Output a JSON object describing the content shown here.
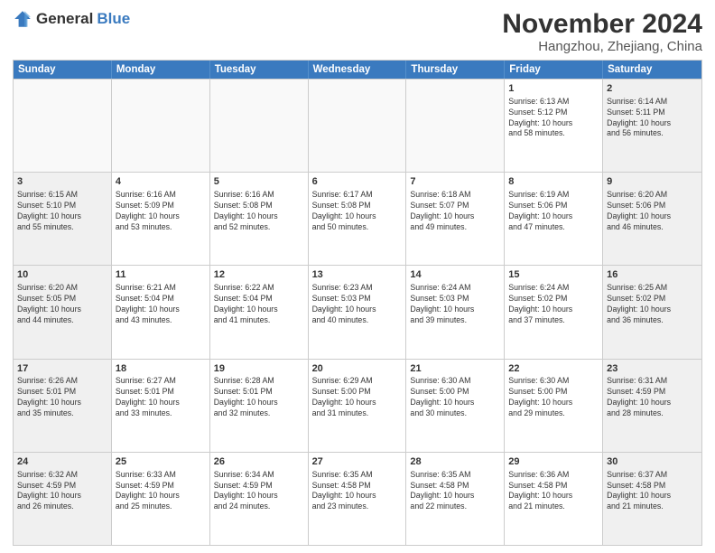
{
  "logo": {
    "general": "General",
    "blue": "Blue"
  },
  "title": "November 2024",
  "location": "Hangzhou, Zhejiang, China",
  "header_days": [
    "Sunday",
    "Monday",
    "Tuesday",
    "Wednesday",
    "Thursday",
    "Friday",
    "Saturday"
  ],
  "weeks": [
    [
      {
        "day": "",
        "text": "",
        "empty": true
      },
      {
        "day": "",
        "text": "",
        "empty": true
      },
      {
        "day": "",
        "text": "",
        "empty": true
      },
      {
        "day": "",
        "text": "",
        "empty": true
      },
      {
        "day": "",
        "text": "",
        "empty": true
      },
      {
        "day": "1",
        "text": "Sunrise: 6:13 AM\nSunset: 5:12 PM\nDaylight: 10 hours\nand 58 minutes.",
        "empty": false
      },
      {
        "day": "2",
        "text": "Sunrise: 6:14 AM\nSunset: 5:11 PM\nDaylight: 10 hours\nand 56 minutes.",
        "empty": false
      }
    ],
    [
      {
        "day": "3",
        "text": "Sunrise: 6:15 AM\nSunset: 5:10 PM\nDaylight: 10 hours\nand 55 minutes.",
        "empty": false
      },
      {
        "day": "4",
        "text": "Sunrise: 6:16 AM\nSunset: 5:09 PM\nDaylight: 10 hours\nand 53 minutes.",
        "empty": false
      },
      {
        "day": "5",
        "text": "Sunrise: 6:16 AM\nSunset: 5:08 PM\nDaylight: 10 hours\nand 52 minutes.",
        "empty": false
      },
      {
        "day": "6",
        "text": "Sunrise: 6:17 AM\nSunset: 5:08 PM\nDaylight: 10 hours\nand 50 minutes.",
        "empty": false
      },
      {
        "day": "7",
        "text": "Sunrise: 6:18 AM\nSunset: 5:07 PM\nDaylight: 10 hours\nand 49 minutes.",
        "empty": false
      },
      {
        "day": "8",
        "text": "Sunrise: 6:19 AM\nSunset: 5:06 PM\nDaylight: 10 hours\nand 47 minutes.",
        "empty": false
      },
      {
        "day": "9",
        "text": "Sunrise: 6:20 AM\nSunset: 5:06 PM\nDaylight: 10 hours\nand 46 minutes.",
        "empty": false
      }
    ],
    [
      {
        "day": "10",
        "text": "Sunrise: 6:20 AM\nSunset: 5:05 PM\nDaylight: 10 hours\nand 44 minutes.",
        "empty": false
      },
      {
        "day": "11",
        "text": "Sunrise: 6:21 AM\nSunset: 5:04 PM\nDaylight: 10 hours\nand 43 minutes.",
        "empty": false
      },
      {
        "day": "12",
        "text": "Sunrise: 6:22 AM\nSunset: 5:04 PM\nDaylight: 10 hours\nand 41 minutes.",
        "empty": false
      },
      {
        "day": "13",
        "text": "Sunrise: 6:23 AM\nSunset: 5:03 PM\nDaylight: 10 hours\nand 40 minutes.",
        "empty": false
      },
      {
        "day": "14",
        "text": "Sunrise: 6:24 AM\nSunset: 5:03 PM\nDaylight: 10 hours\nand 39 minutes.",
        "empty": false
      },
      {
        "day": "15",
        "text": "Sunrise: 6:24 AM\nSunset: 5:02 PM\nDaylight: 10 hours\nand 37 minutes.",
        "empty": false
      },
      {
        "day": "16",
        "text": "Sunrise: 6:25 AM\nSunset: 5:02 PM\nDaylight: 10 hours\nand 36 minutes.",
        "empty": false
      }
    ],
    [
      {
        "day": "17",
        "text": "Sunrise: 6:26 AM\nSunset: 5:01 PM\nDaylight: 10 hours\nand 35 minutes.",
        "empty": false
      },
      {
        "day": "18",
        "text": "Sunrise: 6:27 AM\nSunset: 5:01 PM\nDaylight: 10 hours\nand 33 minutes.",
        "empty": false
      },
      {
        "day": "19",
        "text": "Sunrise: 6:28 AM\nSunset: 5:01 PM\nDaylight: 10 hours\nand 32 minutes.",
        "empty": false
      },
      {
        "day": "20",
        "text": "Sunrise: 6:29 AM\nSunset: 5:00 PM\nDaylight: 10 hours\nand 31 minutes.",
        "empty": false
      },
      {
        "day": "21",
        "text": "Sunrise: 6:30 AM\nSunset: 5:00 PM\nDaylight: 10 hours\nand 30 minutes.",
        "empty": false
      },
      {
        "day": "22",
        "text": "Sunrise: 6:30 AM\nSunset: 5:00 PM\nDaylight: 10 hours\nand 29 minutes.",
        "empty": false
      },
      {
        "day": "23",
        "text": "Sunrise: 6:31 AM\nSunset: 4:59 PM\nDaylight: 10 hours\nand 28 minutes.",
        "empty": false
      }
    ],
    [
      {
        "day": "24",
        "text": "Sunrise: 6:32 AM\nSunset: 4:59 PM\nDaylight: 10 hours\nand 26 minutes.",
        "empty": false
      },
      {
        "day": "25",
        "text": "Sunrise: 6:33 AM\nSunset: 4:59 PM\nDaylight: 10 hours\nand 25 minutes.",
        "empty": false
      },
      {
        "day": "26",
        "text": "Sunrise: 6:34 AM\nSunset: 4:59 PM\nDaylight: 10 hours\nand 24 minutes.",
        "empty": false
      },
      {
        "day": "27",
        "text": "Sunrise: 6:35 AM\nSunset: 4:58 PM\nDaylight: 10 hours\nand 23 minutes.",
        "empty": false
      },
      {
        "day": "28",
        "text": "Sunrise: 6:35 AM\nSunset: 4:58 PM\nDaylight: 10 hours\nand 22 minutes.",
        "empty": false
      },
      {
        "day": "29",
        "text": "Sunrise: 6:36 AM\nSunset: 4:58 PM\nDaylight: 10 hours\nand 21 minutes.",
        "empty": false
      },
      {
        "day": "30",
        "text": "Sunrise: 6:37 AM\nSunset: 4:58 PM\nDaylight: 10 hours\nand 21 minutes.",
        "empty": false
      }
    ]
  ]
}
